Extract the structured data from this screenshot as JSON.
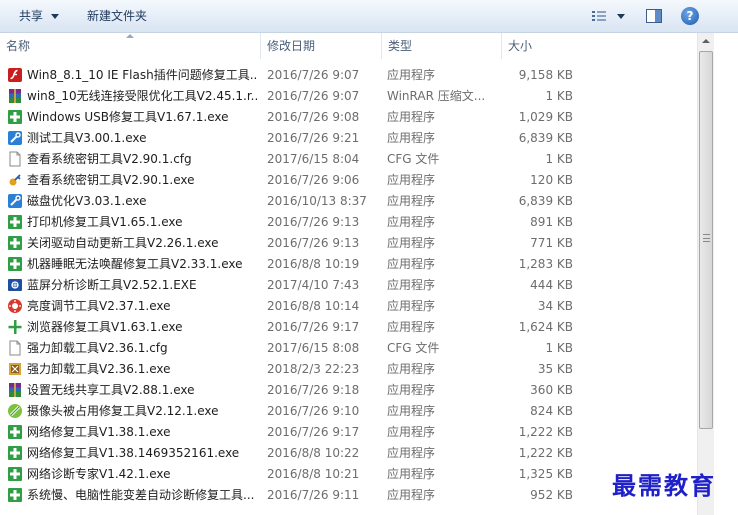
{
  "toolbar": {
    "share_label": "共享",
    "new_folder_label": "新建文件夹",
    "view_icon": "views-icon",
    "pane_icon": "preview-pane-icon",
    "help_icon": "help-icon",
    "help_glyph": "?"
  },
  "columns": {
    "name": "名称",
    "date": "修改日期",
    "type": "类型",
    "size": "大小"
  },
  "files": [
    {
      "name": "Win8_8.1_10 IE Flash插件问题修复工具...",
      "date": "2016/7/26 9:07",
      "type": "应用程序",
      "size": "9,158 KB",
      "icon": "flash"
    },
    {
      "name": "win8_10无线连接受限优化工具V2.45.1.r...",
      "date": "2016/7/26 9:07",
      "type": "WinRAR 压缩文...",
      "size": "1 KB",
      "icon": "winrar"
    },
    {
      "name": "Windows USB修复工具V1.67.1.exe",
      "date": "2016/7/26 9:08",
      "type": "应用程序",
      "size": "1,029 KB",
      "icon": "green-cross"
    },
    {
      "name": "测试工具V3.00.1.exe",
      "date": "2016/7/26 9:21",
      "type": "应用程序",
      "size": "6,839 KB",
      "icon": "tools"
    },
    {
      "name": "查看系统密钥工具V2.90.1.cfg",
      "date": "2017/6/15 8:04",
      "type": "CFG 文件",
      "size": "1 KB",
      "icon": "document"
    },
    {
      "name": "查看系统密钥工具V2.90.1.exe",
      "date": "2016/7/26 9:06",
      "type": "应用程序",
      "size": "120 KB",
      "icon": "key"
    },
    {
      "name": "磁盘优化V3.03.1.exe",
      "date": "2016/10/13 8:37",
      "type": "应用程序",
      "size": "6,839 KB",
      "icon": "tools"
    },
    {
      "name": "打印机修复工具V1.65.1.exe",
      "date": "2016/7/26 9:13",
      "type": "应用程序",
      "size": "891 KB",
      "icon": "green-cross"
    },
    {
      "name": "关闭驱动自动更新工具V2.26.1.exe",
      "date": "2016/7/26 9:13",
      "type": "应用程序",
      "size": "771 KB",
      "icon": "green-cross"
    },
    {
      "name": "机器睡眠无法唤醒修复工具V2.33.1.exe",
      "date": "2016/8/8 10:19",
      "type": "应用程序",
      "size": "1,283 KB",
      "icon": "green-cross"
    },
    {
      "name": "蓝屏分析诊断工具V2.52.1.EXE",
      "date": "2017/4/10 7:43",
      "type": "应用程序",
      "size": "444 KB",
      "icon": "bluescreen"
    },
    {
      "name": "亮度调节工具V2.37.1.exe",
      "date": "2016/8/8 10:14",
      "type": "应用程序",
      "size": "34 KB",
      "icon": "brightness"
    },
    {
      "name": "浏览器修复工具V1.63.1.exe",
      "date": "2016/7/26 9:17",
      "type": "应用程序",
      "size": "1,624 KB",
      "icon": "plus"
    },
    {
      "name": "强力卸载工具V2.36.1.cfg",
      "date": "2017/6/15 8:08",
      "type": "CFG 文件",
      "size": "1 KB",
      "icon": "document"
    },
    {
      "name": "强力卸载工具V2.36.1.exe",
      "date": "2018/2/3 22:23",
      "type": "应用程序",
      "size": "35 KB",
      "icon": "uninstall"
    },
    {
      "name": "设置无线共享工具V2.88.1.exe",
      "date": "2016/7/26 9:18",
      "type": "应用程序",
      "size": "360 KB",
      "icon": "winrar"
    },
    {
      "name": "摄像头被占用修复工具V2.12.1.exe",
      "date": "2016/7/26 9:10",
      "type": "应用程序",
      "size": "824 KB",
      "icon": "camera"
    },
    {
      "name": "网络修复工具V1.38.1.exe",
      "date": "2016/7/26 9:17",
      "type": "应用程序",
      "size": "1,222 KB",
      "icon": "green-cross"
    },
    {
      "name": "网络修复工具V1.38.1469352161.exe",
      "date": "2016/8/8 10:22",
      "type": "应用程序",
      "size": "1,222 KB",
      "icon": "green-cross"
    },
    {
      "name": "网络诊断专家V1.42.1.exe",
      "date": "2016/8/8 10:21",
      "type": "应用程序",
      "size": "1,325 KB",
      "icon": "green-cross"
    },
    {
      "name": "系统慢、电脑性能变差自动诊断修复工具...",
      "date": "2016/7/26 9:11",
      "type": "应用程序",
      "size": "952 KB",
      "icon": "green-cross"
    }
  ],
  "watermark": "最需教育"
}
